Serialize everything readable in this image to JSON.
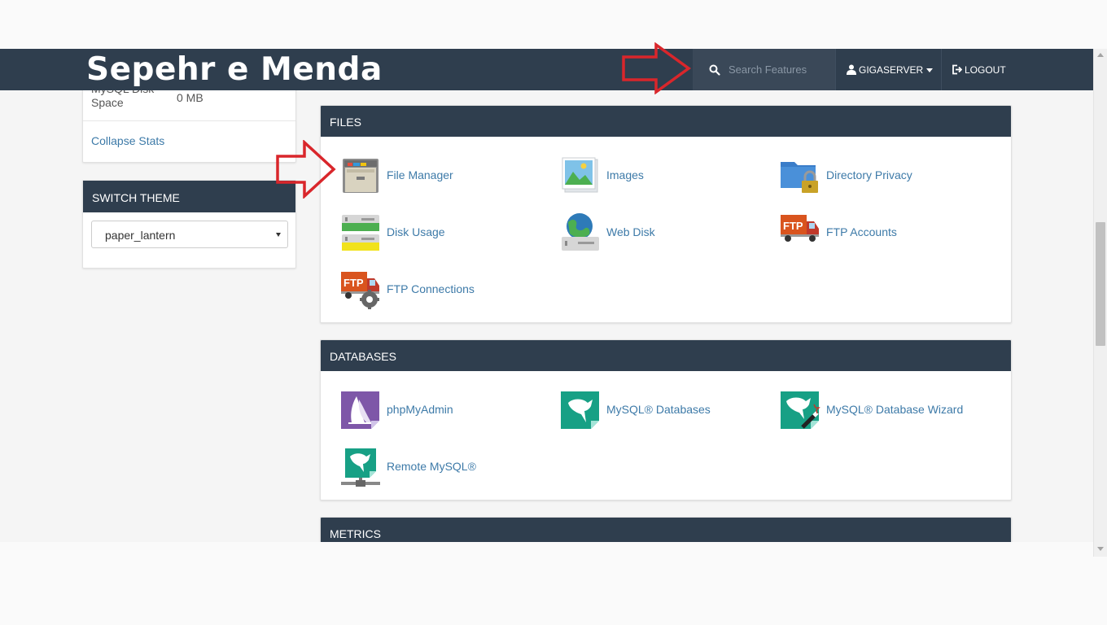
{
  "header": {
    "brand": "Sepehr e Menda",
    "search_placeholder": "Search Features",
    "user_label": "GIGASERVER",
    "logout_label": "LOGOUT"
  },
  "sidebar": {
    "stat": {
      "label": "MySQL Disk Space",
      "value": "0 MB"
    },
    "collapse_label": "Collapse Stats",
    "theme": {
      "title": "SWITCH THEME",
      "selected": "paper_lantern"
    }
  },
  "sections": {
    "files": {
      "title": "FILES",
      "items": [
        {
          "label": "File Manager",
          "icon": "file-manager-icon"
        },
        {
          "label": "Images",
          "icon": "images-icon"
        },
        {
          "label": "Directory Privacy",
          "icon": "directory-privacy-icon"
        },
        {
          "label": "Disk Usage",
          "icon": "disk-usage-icon"
        },
        {
          "label": "Web Disk",
          "icon": "web-disk-icon"
        },
        {
          "label": "FTP Accounts",
          "icon": "ftp-accounts-icon"
        },
        {
          "label": "FTP Connections",
          "icon": "ftp-connections-icon"
        }
      ]
    },
    "databases": {
      "title": "DATABASES",
      "items": [
        {
          "label": "phpMyAdmin",
          "icon": "phpmyadmin-icon"
        },
        {
          "label": "MySQL® Databases",
          "icon": "mysql-databases-icon"
        },
        {
          "label": "MySQL® Database Wizard",
          "icon": "mysql-wizard-icon"
        },
        {
          "label": "Remote MySQL®",
          "icon": "remote-mysql-icon"
        }
      ]
    },
    "metrics": {
      "title": "METRICS"
    }
  },
  "colors": {
    "header_bg": "#2f3e4e",
    "link": "#3d7aa8",
    "annotation_arrow": "#d9262b"
  }
}
